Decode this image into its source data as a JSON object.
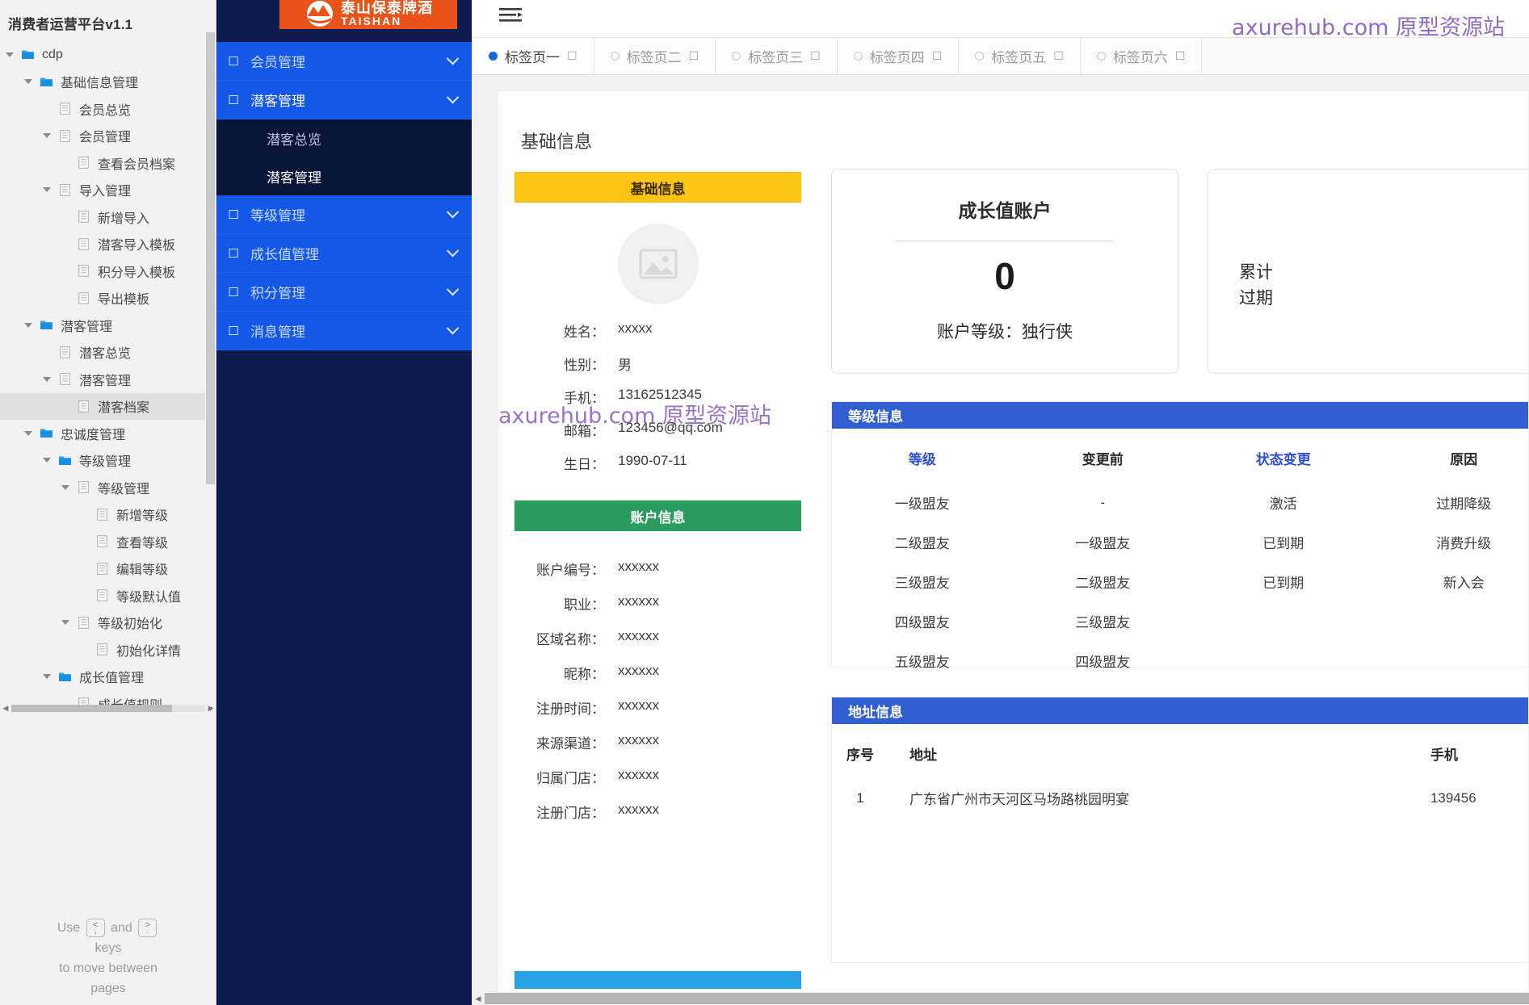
{
  "sitemap": {
    "title": "消费者运营平台v1.1",
    "nodes": [
      {
        "label": "cdp",
        "depth": 0,
        "icon": "folder",
        "caret": true,
        "selected": false
      },
      {
        "label": "基础信息管理",
        "depth": 1,
        "icon": "folder",
        "caret": true,
        "selected": false
      },
      {
        "label": "会员总览",
        "depth": 2,
        "icon": "page",
        "caret": false,
        "selected": false
      },
      {
        "label": "会员管理",
        "depth": 2,
        "icon": "page",
        "caret": true,
        "selected": false
      },
      {
        "label": "查看会员档案",
        "depth": 3,
        "icon": "page",
        "caret": false,
        "selected": false
      },
      {
        "label": "导入管理",
        "depth": 2,
        "icon": "page",
        "caret": true,
        "selected": false
      },
      {
        "label": "新增导入",
        "depth": 3,
        "icon": "page",
        "caret": false,
        "selected": false
      },
      {
        "label": "潜客导入模板",
        "depth": 3,
        "icon": "page",
        "caret": false,
        "selected": false
      },
      {
        "label": "积分导入模板",
        "depth": 3,
        "icon": "page",
        "caret": false,
        "selected": false
      },
      {
        "label": "导出模板",
        "depth": 3,
        "icon": "page",
        "caret": false,
        "selected": false
      },
      {
        "label": "潜客管理",
        "depth": 1,
        "icon": "folder",
        "caret": true,
        "selected": false
      },
      {
        "label": "潜客总览",
        "depth": 2,
        "icon": "page",
        "caret": false,
        "selected": false
      },
      {
        "label": "潜客管理",
        "depth": 2,
        "icon": "page",
        "caret": true,
        "selected": false
      },
      {
        "label": "潜客档案",
        "depth": 3,
        "icon": "page",
        "caret": false,
        "selected": true
      },
      {
        "label": "忠诚度管理",
        "depth": 1,
        "icon": "folder",
        "caret": true,
        "selected": false
      },
      {
        "label": "等级管理",
        "depth": 2,
        "icon": "folder",
        "caret": true,
        "selected": false
      },
      {
        "label": "等级管理",
        "depth": 3,
        "icon": "page",
        "caret": true,
        "selected": false
      },
      {
        "label": "新增等级",
        "depth": 4,
        "icon": "page",
        "caret": false,
        "selected": false
      },
      {
        "label": "查看等级",
        "depth": 4,
        "icon": "page",
        "caret": false,
        "selected": false
      },
      {
        "label": "编辑等级",
        "depth": 4,
        "icon": "page",
        "caret": false,
        "selected": false
      },
      {
        "label": "等级默认值",
        "depth": 4,
        "icon": "page",
        "caret": false,
        "selected": false
      },
      {
        "label": "等级初始化",
        "depth": 3,
        "icon": "page",
        "caret": true,
        "selected": false
      },
      {
        "label": "初始化详情",
        "depth": 4,
        "icon": "page",
        "caret": false,
        "selected": false
      },
      {
        "label": "成长值管理",
        "depth": 2,
        "icon": "folder",
        "caret": true,
        "selected": false
      },
      {
        "label": "成长值规则",
        "depth": 3,
        "icon": "page",
        "caret": false,
        "selected": false
      }
    ],
    "page_hint": {
      "use": "Use",
      "and": "and",
      "keys": "keys",
      "line3": "to move between",
      "line4": "pages",
      "key_prev_top": "<",
      "key_prev_bottom": ",",
      "key_next_top": ">",
      "key_next_bottom": "."
    }
  },
  "nav": {
    "logo": {
      "cn": "泰山保泰牌酒",
      "en": "TAISHAN"
    },
    "items": [
      {
        "label": "会员管理",
        "active": false,
        "expanded": false
      },
      {
        "label": "潜客管理",
        "active": true,
        "expanded": true
      },
      {
        "label": "等级管理",
        "active": false,
        "expanded": false
      },
      {
        "label": "成长值管理",
        "active": false,
        "expanded": false
      },
      {
        "label": "积分管理",
        "active": false,
        "expanded": false
      },
      {
        "label": "消息管理",
        "active": false,
        "expanded": false
      }
    ],
    "sub_items": [
      {
        "label": "潜客总览",
        "active": false
      },
      {
        "label": "潜客管理",
        "active": true
      }
    ]
  },
  "tabs": [
    {
      "label": "标签页一",
      "active": true
    },
    {
      "label": "标签页二",
      "active": false
    },
    {
      "label": "标签页三",
      "active": false
    },
    {
      "label": "标签页四",
      "active": false
    },
    {
      "label": "标签页五",
      "active": false
    },
    {
      "label": "标签页六",
      "active": false
    }
  ],
  "watermark": "axurehub.com 原型资源站",
  "page": {
    "title": "基础信息",
    "basic_card": {
      "header": "基础信息",
      "fields": [
        {
          "label": "姓名：",
          "value": "xxxxx"
        },
        {
          "label": "性别：",
          "value": "男"
        },
        {
          "label": "手机：",
          "value": "13162512345"
        },
        {
          "label": "邮箱：",
          "value": "123456@qq.com"
        },
        {
          "label": "生日：",
          "value": "1990-07-11"
        }
      ]
    },
    "account_card": {
      "header": "账户信息",
      "fields": [
        {
          "label": "账户编号：",
          "value": "xxxxxx"
        },
        {
          "label": "职业：",
          "value": "xxxxxx"
        },
        {
          "label": "区域名称：",
          "value": "xxxxxx"
        },
        {
          "label": "昵称：",
          "value": "xxxxxx"
        },
        {
          "label": "注册时间：",
          "value": "xxxxxx"
        },
        {
          "label": "来源渠道：",
          "value": "xxxxxx"
        },
        {
          "label": "归属门店：",
          "value": "xxxxxx"
        },
        {
          "label": "注册门店：",
          "value": "xxxxxx"
        }
      ]
    },
    "growth_card": {
      "title": "成长值账户",
      "value": "0",
      "level_text": "账户等级：独行侠"
    },
    "points_card": {
      "line1": "累计",
      "line2": "过期"
    },
    "grade_table": {
      "header": "等级信息",
      "columns": [
        "等级",
        "变更前",
        "状态变更",
        "原因"
      ],
      "rows": [
        [
          "一级盟友",
          "-",
          "激活",
          "过期降级"
        ],
        [
          "二级盟友",
          "一级盟友",
          "已到期",
          "消费升级"
        ],
        [
          "三级盟友",
          "二级盟友",
          "已到期",
          "新入会"
        ],
        [
          "四级盟友",
          "三级盟友",
          "",
          ""
        ],
        [
          "五级盟友",
          "四级盟友",
          "",
          ""
        ]
      ]
    },
    "address_table": {
      "header": "地址信息",
      "columns": [
        "序号",
        "地址",
        "手机"
      ],
      "rows": [
        [
          "1",
          "广东省广州市天河区马场路桃园明宴",
          "139456"
        ]
      ]
    }
  },
  "colors": {
    "brand_orange": "#e8531a",
    "nav_blue": "#1458e8",
    "nav_dark": "#0d1c4f",
    "accent_yellow": "#fbc412",
    "accent_green": "#2a9d5e",
    "accent_blue": "#2f5fd0",
    "strip_blue": "#29a3e8",
    "watermark_purple": "#8e63bf"
  }
}
